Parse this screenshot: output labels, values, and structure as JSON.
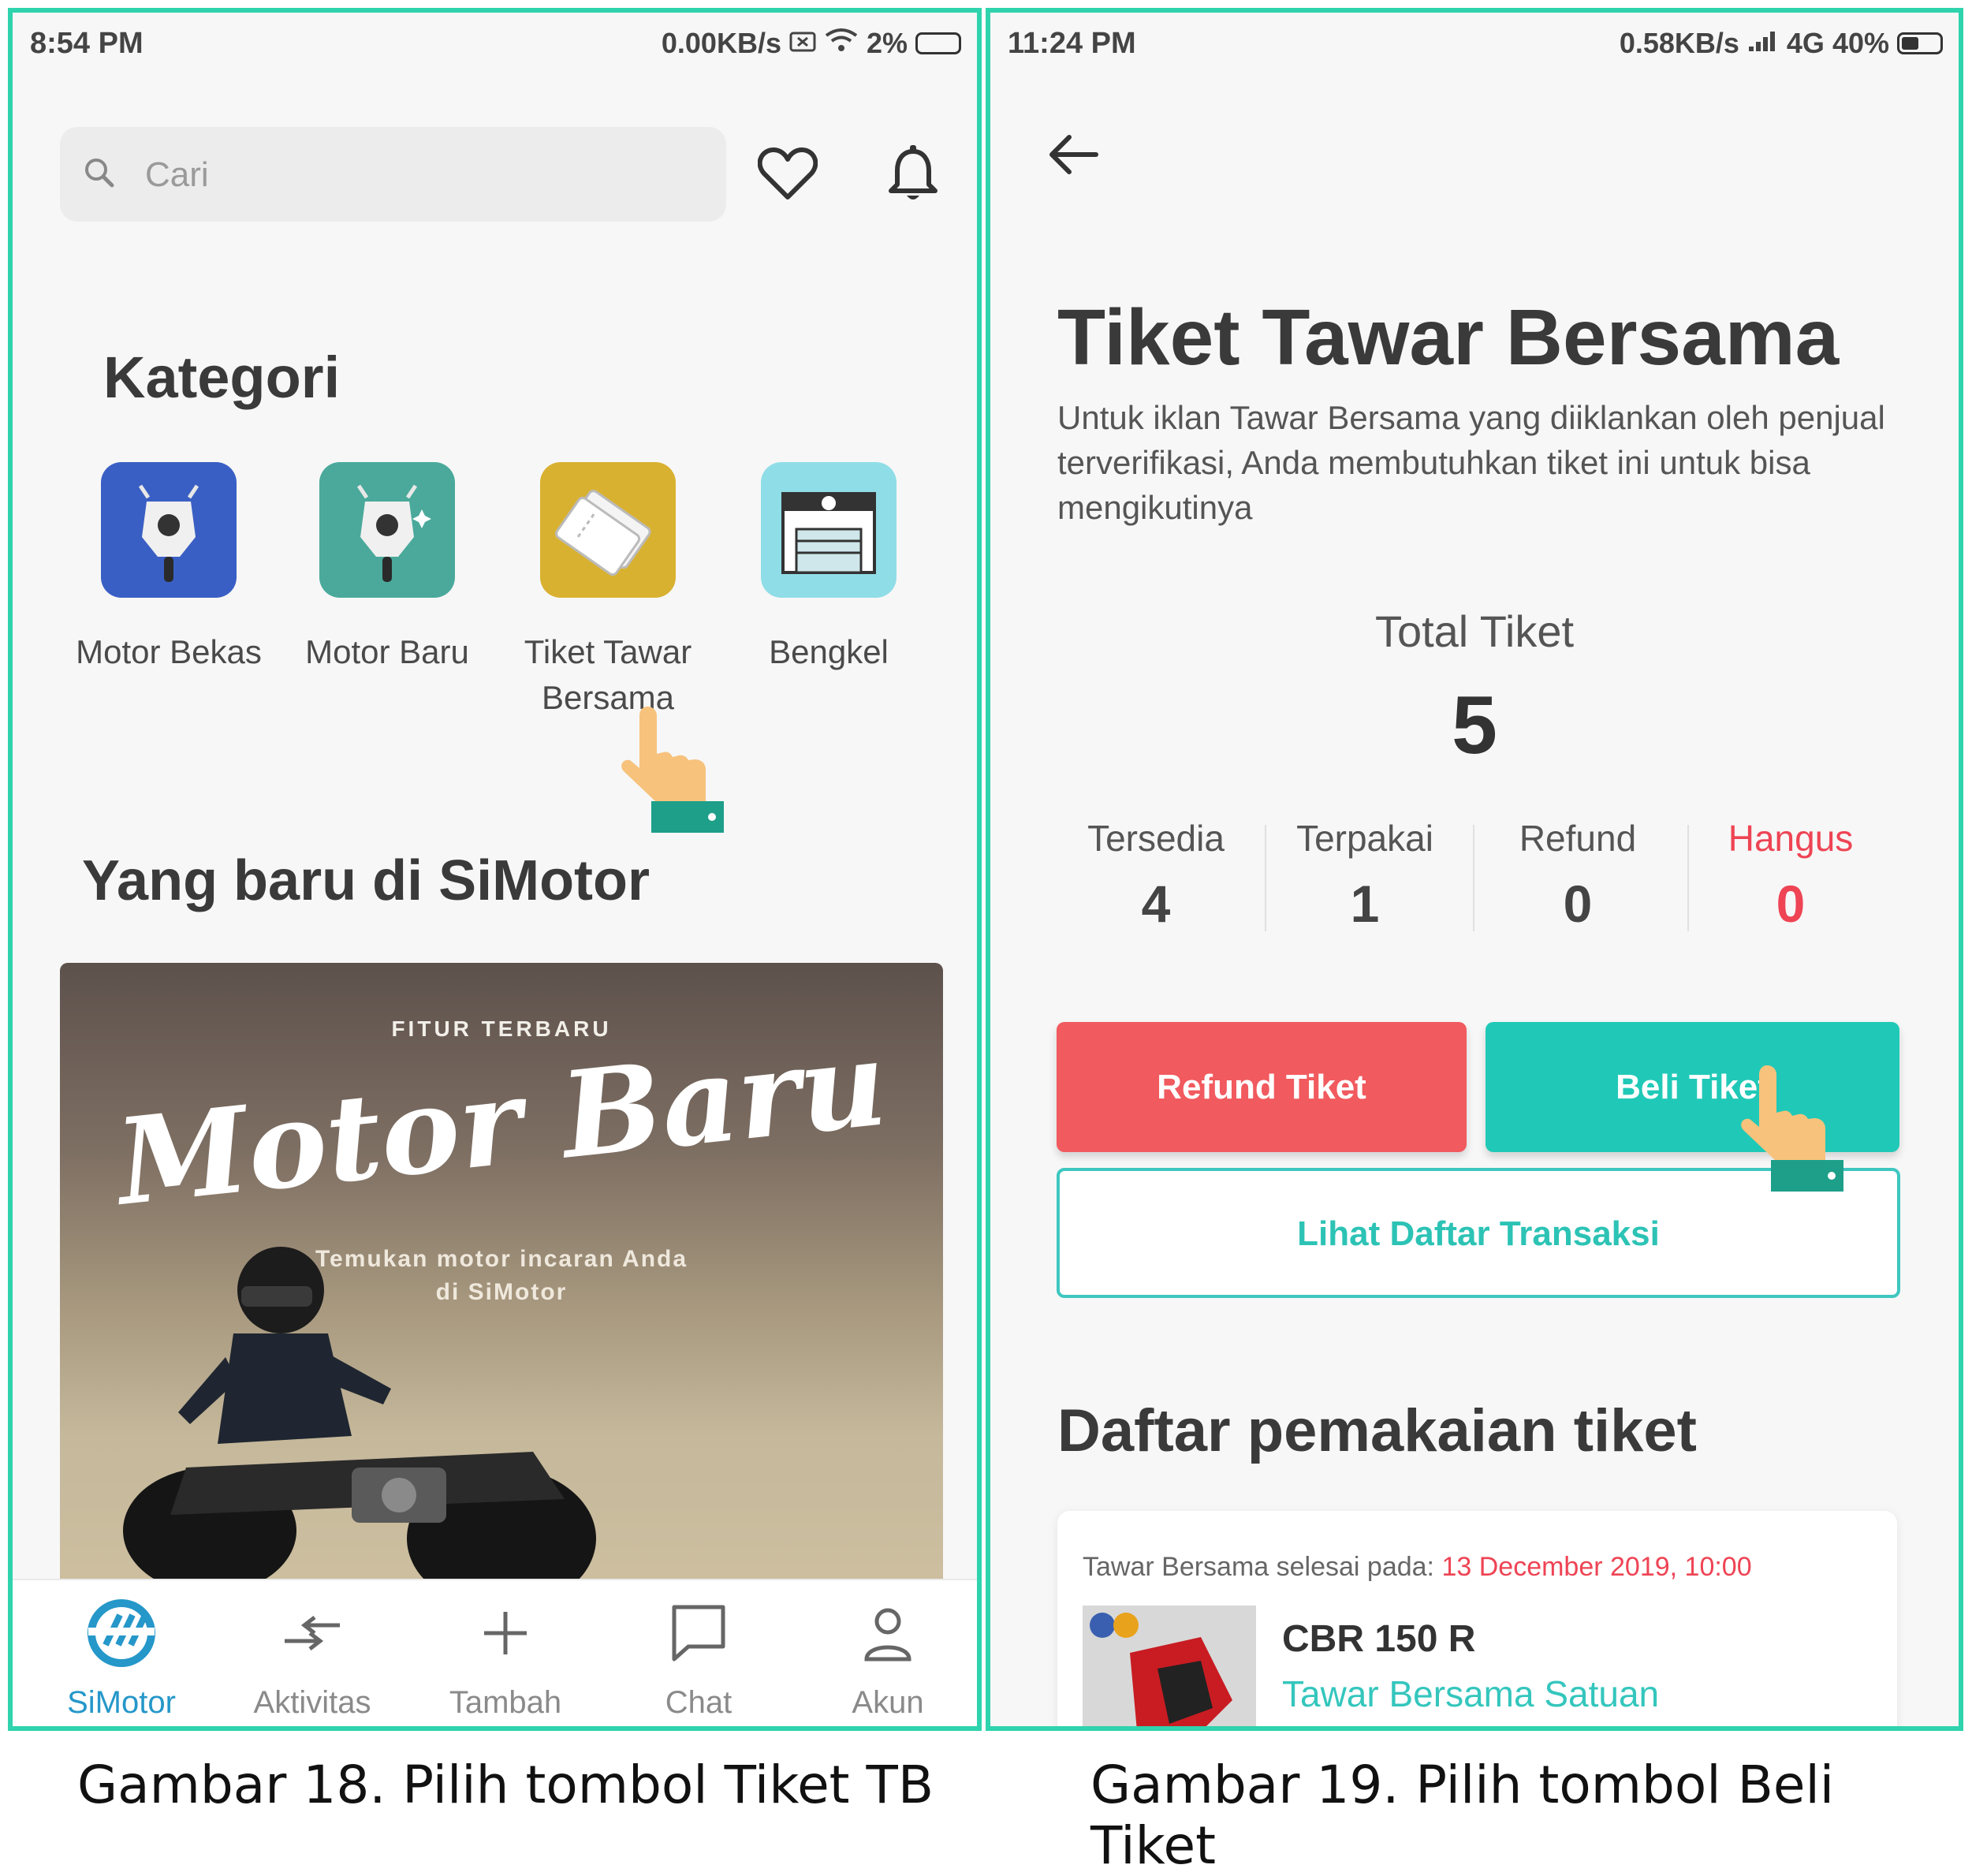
{
  "left_screen": {
    "status": {
      "time": "8:54 PM",
      "speed": "0.00KB/s",
      "battery": "2%"
    },
    "search": {
      "placeholder": "Cari"
    },
    "kategori_title": "Kategori",
    "categories": [
      {
        "label": "Motor Bekas",
        "color": "#3a5fc4"
      },
      {
        "label": "Motor Baru",
        "color": "#4aa99b"
      },
      {
        "label": "Tiket Tawar Bersama",
        "color": "#d9b130"
      },
      {
        "label": "Bengkel",
        "color": "#8fdde7"
      }
    ],
    "section_title": "Yang baru di SiMotor",
    "banner": {
      "top": "FITUR TERBARU",
      "script": "Motor Baru",
      "sub1": "Temukan motor incaran Anda",
      "sub2": "di SiMotor"
    },
    "nav": [
      {
        "label": "SiMotor",
        "icon": "simotor-logo-icon",
        "active": true
      },
      {
        "label": "Aktivitas",
        "icon": "swap-arrows-icon"
      },
      {
        "label": "Tambah",
        "icon": "plus-icon"
      },
      {
        "label": "Chat",
        "icon": "chat-bubble-icon"
      },
      {
        "label": "Akun",
        "icon": "person-icon"
      }
    ]
  },
  "right_screen": {
    "status": {
      "time": "11:24 PM",
      "speed": "0.58KB/s",
      "network": "4G",
      "battery": "40%"
    },
    "title": "Tiket Tawar Bersama",
    "description": "Untuk iklan Tawar Bersama yang diiklankan oleh penjual terverifikasi, Anda membutuhkan tiket ini untuk bisa mengikutinya",
    "total_label": "Total Tiket",
    "total_value": "5",
    "stats": [
      {
        "label": "Tersedia",
        "value": "4"
      },
      {
        "label": "Terpakai",
        "value": "1"
      },
      {
        "label": "Refund",
        "value": "0"
      },
      {
        "label": "Hangus",
        "value": "0",
        "color": "#ee4454"
      }
    ],
    "buttons": {
      "refund": "Refund Tiket",
      "beli": "Beli Tiket",
      "lihat": "Lihat Daftar Transaksi"
    },
    "usage_title": "Daftar pemakaian tiket",
    "card": {
      "prefix": "Tawar Bersama selesai pada:",
      "date": "13 December 2019, 10:00",
      "name": "CBR 150 R",
      "type": "Tawar Bersama Satuan"
    }
  },
  "captions": {
    "left": "Gambar 18. Pilih tombol Tiket TB",
    "right": "Gambar 19. Pilih tombol Beli Tiket"
  },
  "colors": {
    "border": "#2fd3ad",
    "teal": "#20c9b7",
    "red": "#f15a5e",
    "hand": "#f7c27c"
  }
}
